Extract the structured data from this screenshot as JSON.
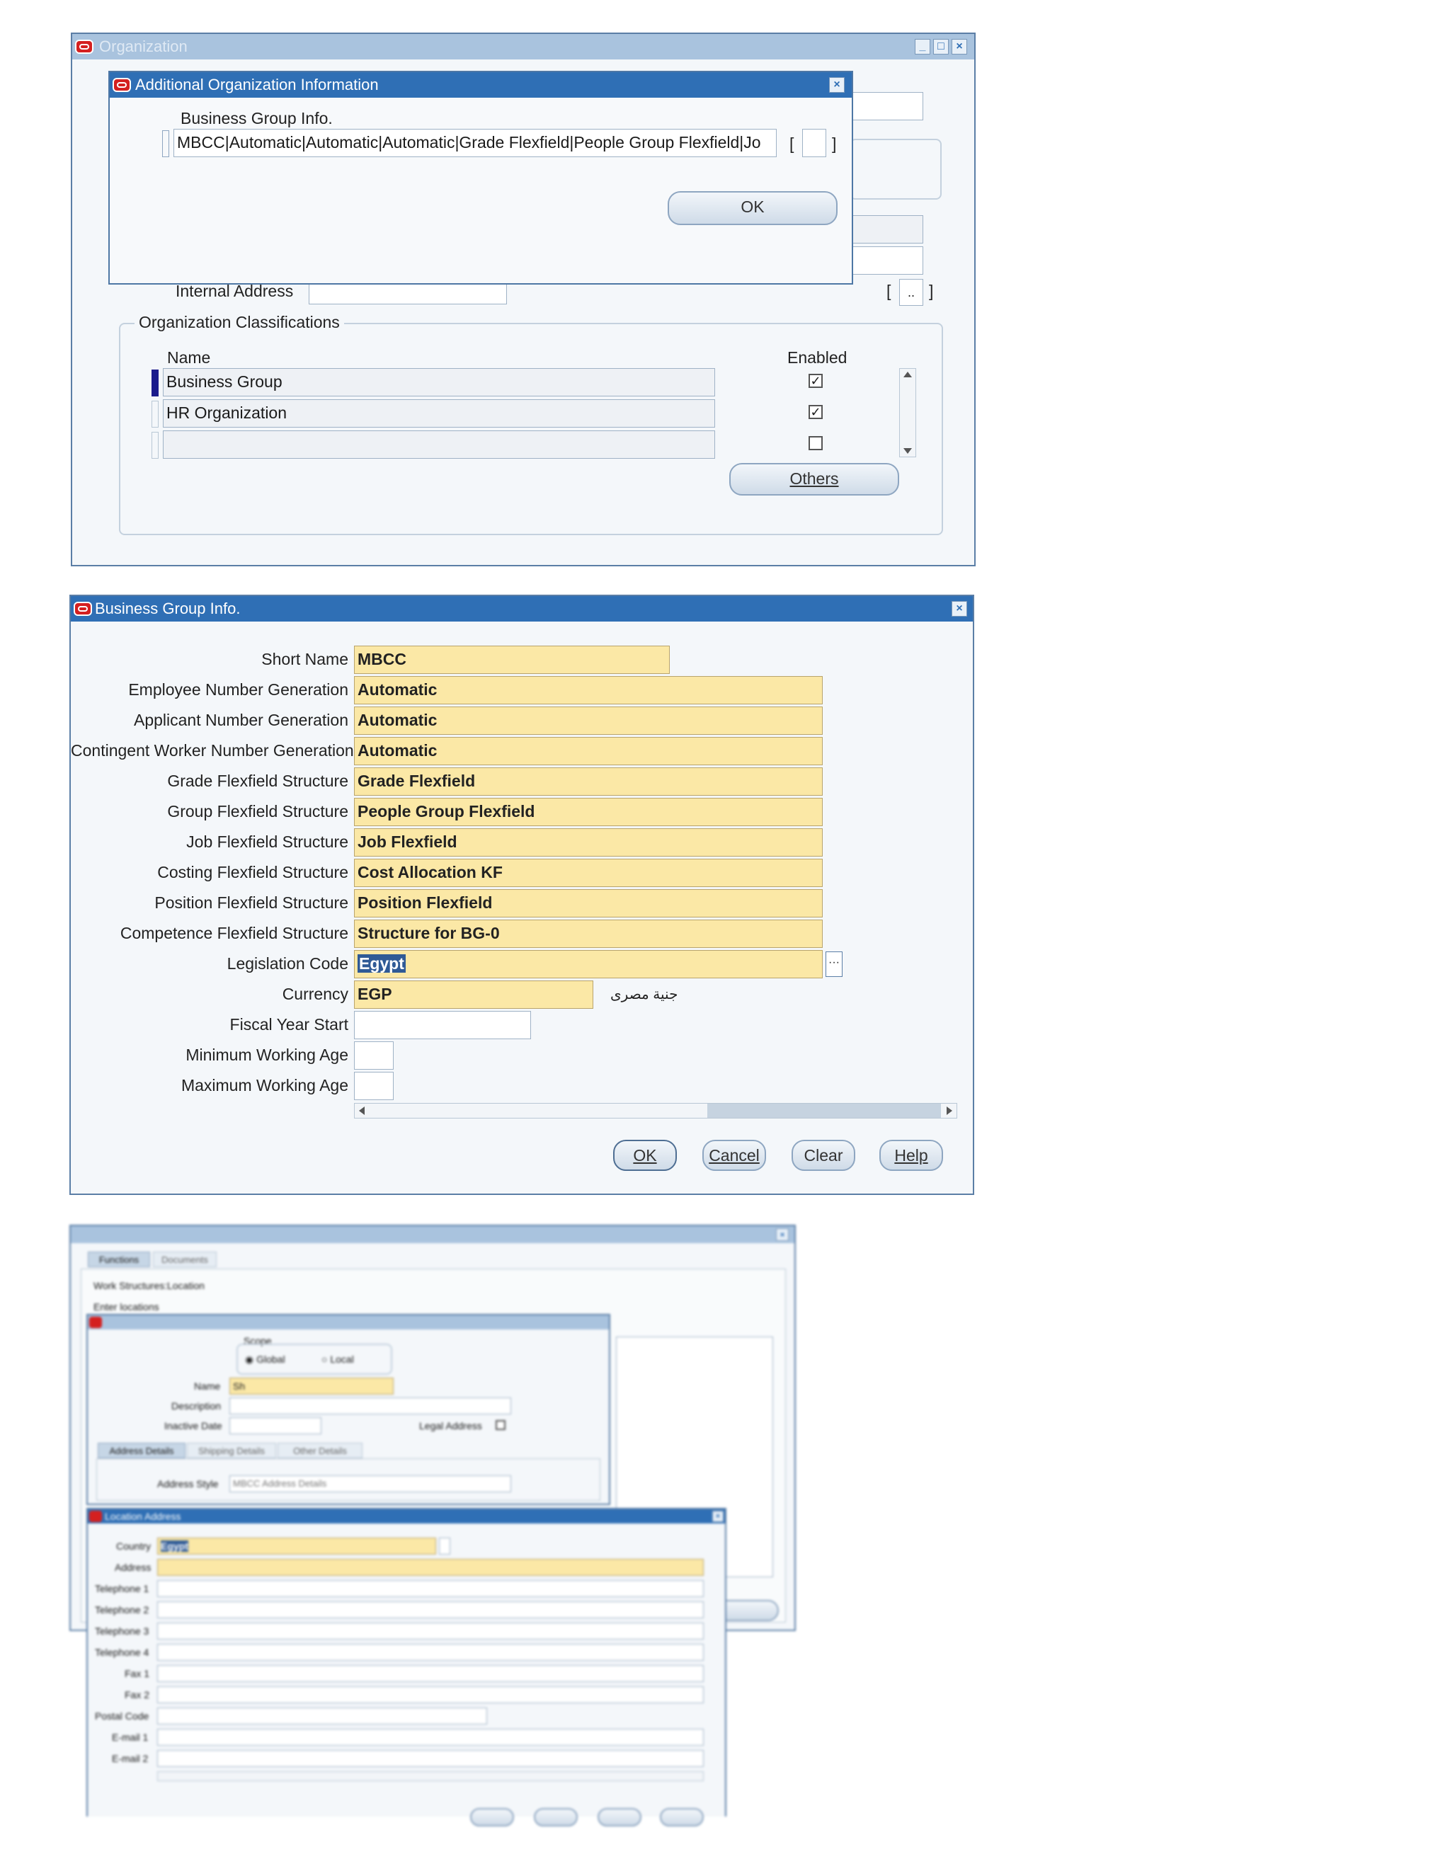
{
  "panel1": {
    "window_title": "Organization",
    "dialog_title": "Additional Organization Information",
    "bg_info_label": "Business Group Info.",
    "bg_info_value": "MBCC|Automatic|Automatic|Automatic|Grade Flexfield|People Group Flexfield|Jo",
    "ok_label": "OK",
    "internal_address_label": "Internal Address",
    "lov_label": "..",
    "classifications_label": "Organization Classifications",
    "name_col": "Name",
    "enabled_col": "Enabled",
    "rows": [
      {
        "name": "Business Group",
        "enabled": true
      },
      {
        "name": "HR Organization",
        "enabled": true
      },
      {
        "name": "",
        "enabled": false
      }
    ],
    "others_label": "Others"
  },
  "panel2": {
    "window_title": "Business Group Info.",
    "fields": [
      {
        "label": "Short Name",
        "value": "MBCC"
      },
      {
        "label": "Employee Number Generation",
        "value": "Automatic"
      },
      {
        "label": "Applicant Number Generation",
        "value": "Automatic"
      },
      {
        "label": "Contingent Worker Number Generation",
        "value": "Automatic"
      },
      {
        "label": "Grade Flexfield Structure",
        "value": "Grade Flexfield"
      },
      {
        "label": "Group Flexfield Structure",
        "value": "People Group Flexfield"
      },
      {
        "label": "Job Flexfield Structure",
        "value": "Job Flexfield"
      },
      {
        "label": "Costing Flexfield Structure",
        "value": "Cost Allocation KF"
      },
      {
        "label": "Position Flexfield Structure",
        "value": "Position Flexfield"
      },
      {
        "label": "Competence Flexfield Structure",
        "value": "Structure for BG-0"
      },
      {
        "label": "Legislation Code",
        "value": "Egypt"
      },
      {
        "label": "Currency",
        "value": "EGP"
      },
      {
        "label": "Fiscal Year Start",
        "value": ""
      },
      {
        "label": "Minimum Working Age",
        "value": ""
      },
      {
        "label": "Maximum Working Age",
        "value": ""
      }
    ],
    "currency_desc": "جنية مصرى",
    "buttons": {
      "ok": "OK",
      "cancel": "Cancel",
      "clear": "Clear",
      "help": "Help"
    }
  },
  "panel3": {
    "tabs": [
      "Functions",
      "Documents"
    ],
    "path1": "Work Structures:Location",
    "path2": "Enter locations",
    "scope_label": "Scope",
    "scope_global": "Global",
    "scope_local": "Local",
    "name_label": "Name",
    "name_value": "Sh",
    "description_label": "Description",
    "inactive_date_label": "Inactive Date",
    "legal_address_label": "Legal Address",
    "subtabs": [
      "Address Details",
      "Shipping Details",
      "Other Details"
    ],
    "address_style_label": "Address Style",
    "address_style_value": "MBCC Address Details",
    "location_address_title": "Location Address",
    "address_fields": [
      {
        "label": "Country",
        "value": "Egypt"
      },
      {
        "label": "Address",
        "value": ""
      },
      {
        "label": "Telephone 1",
        "value": ""
      },
      {
        "label": "Telephone 2",
        "value": ""
      },
      {
        "label": "Telephone 3",
        "value": ""
      },
      {
        "label": "Telephone 4",
        "value": ""
      },
      {
        "label": "Fax 1",
        "value": ""
      },
      {
        "label": "Fax 2",
        "value": ""
      },
      {
        "label": "Postal Code",
        "value": ""
      },
      {
        "label": "E-mail 1",
        "value": ""
      },
      {
        "label": "E-mail 2",
        "value": ""
      }
    ]
  }
}
